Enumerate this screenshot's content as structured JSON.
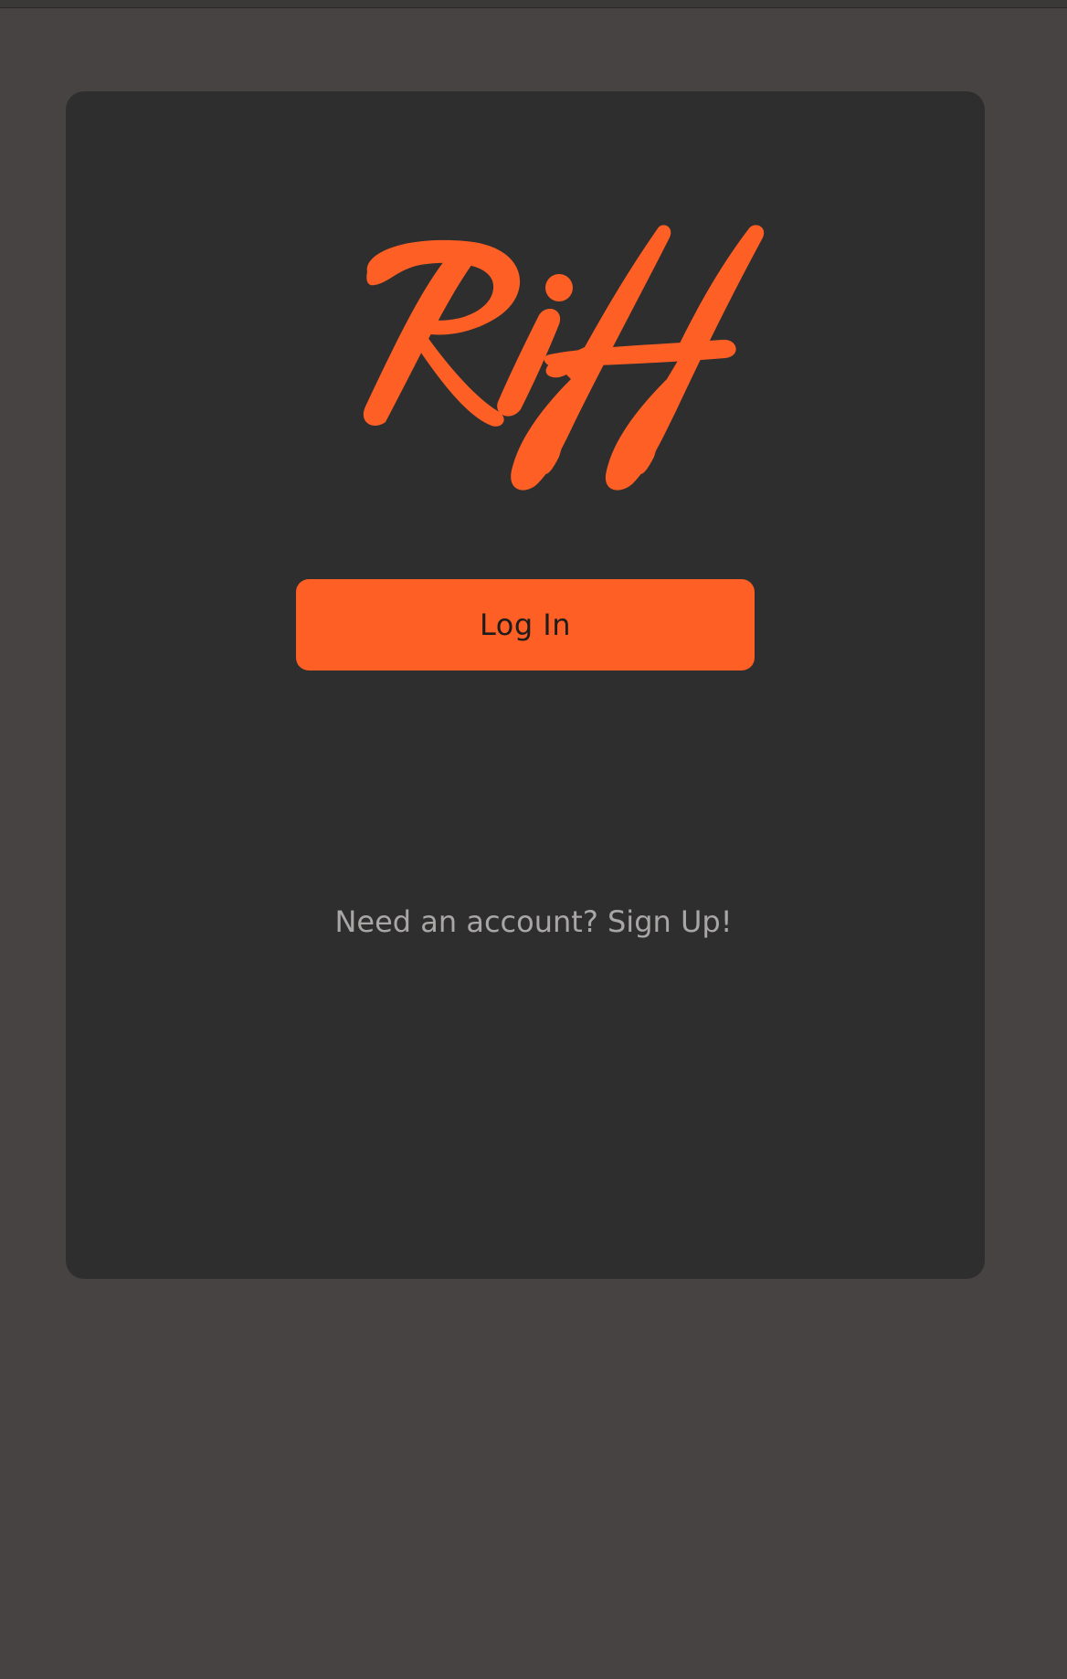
{
  "brand": {
    "logo_text": "Riff",
    "accent_color": "#fd5f25"
  },
  "auth": {
    "login_label": "Log In",
    "signup_prompt": "Need an account?",
    "signup_link": "Sign Up!"
  },
  "colors": {
    "page_background": "#474343",
    "card_background": "#2f2e2e",
    "muted_text": "#a9a6a6"
  }
}
